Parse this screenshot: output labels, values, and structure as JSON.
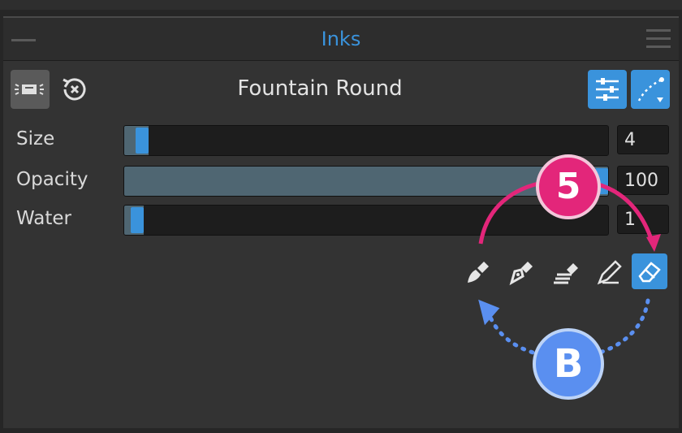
{
  "panel": {
    "title": "Inks"
  },
  "brush": {
    "name": "Fountain Round"
  },
  "icons": {
    "tool": "brush-settings-icon",
    "reset": "reset-brush-icon",
    "adjust": "sliders-icon",
    "stroke": "stroke-preview-icon",
    "collapse": "collapse-icon",
    "menu": "menu-icon"
  },
  "sliders": [
    {
      "label": "Size",
      "value": "4",
      "level": 0.02
    },
    {
      "label": "Opacity",
      "value": "100",
      "level": 1.0
    },
    {
      "label": "Water",
      "value": "1",
      "level": 0.01
    }
  ],
  "nibs": [
    {
      "name": "paint-nib-icon",
      "selected": false
    },
    {
      "name": "pen-nib-icon",
      "selected": false
    },
    {
      "name": "charcoal-nib-icon",
      "selected": false
    },
    {
      "name": "pencil-nib-icon",
      "selected": false
    },
    {
      "name": "eraser-nib-icon",
      "selected": true
    }
  ],
  "annotations": {
    "step": "5",
    "shortcut": "B"
  },
  "colors": {
    "accent": "#3a93dc",
    "step_badge": "#e3267a",
    "shortcut_badge": "#5a8ff0"
  }
}
